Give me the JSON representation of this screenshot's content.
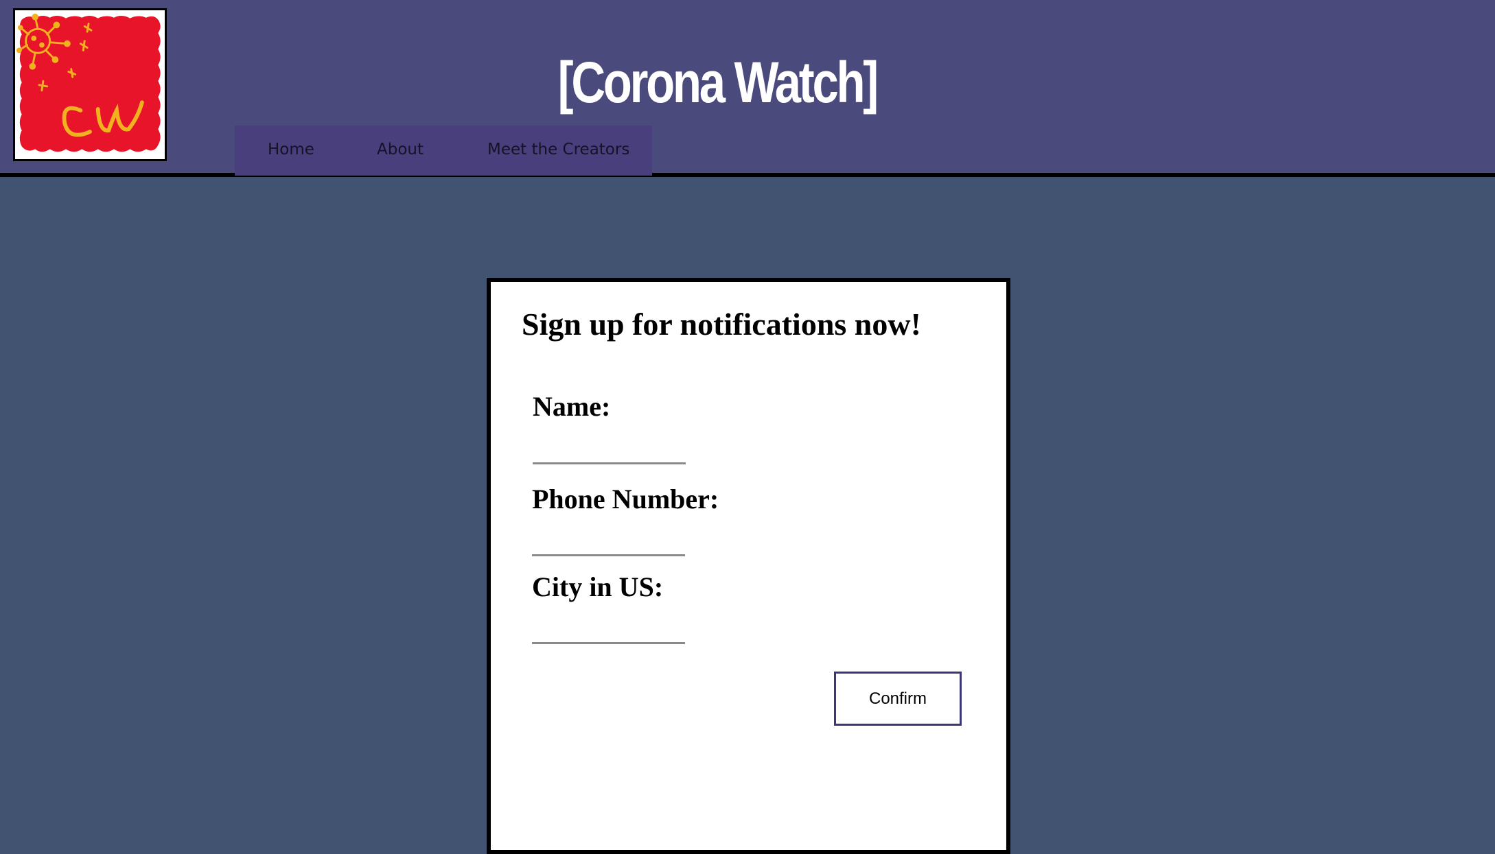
{
  "header": {
    "logo_text": "CW",
    "title": "[Corona Watch]",
    "nav": [
      {
        "label": "Home"
      },
      {
        "label": "About"
      },
      {
        "label": "Meet the Creators"
      }
    ]
  },
  "form": {
    "title": "Sign up for notifications now!",
    "fields": [
      {
        "label": "Name:",
        "value": "",
        "placeholder": ""
      },
      {
        "label": "Phone Number:",
        "value": "",
        "placeholder": ""
      },
      {
        "label": "City in US:",
        "value": "",
        "placeholder": ""
      }
    ],
    "confirm_label": "Confirm"
  },
  "colors": {
    "header_bg": "#4b4a7c",
    "nav_bg": "#4a3f7d",
    "page_bg": "#425372",
    "logo_red": "#e8152a",
    "logo_yellow": "#f2b21f",
    "button_border": "#3b3775"
  }
}
